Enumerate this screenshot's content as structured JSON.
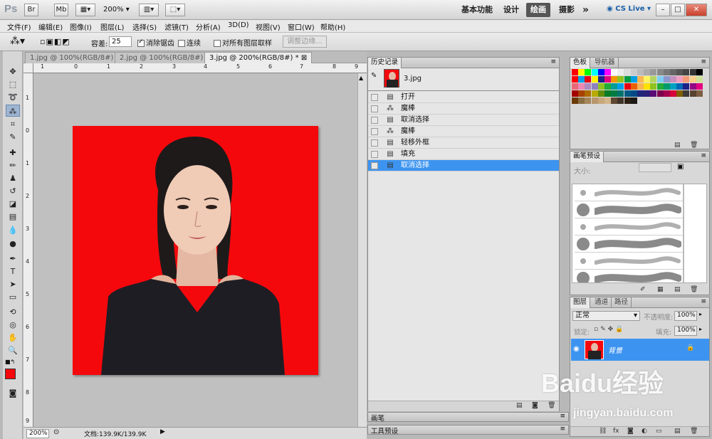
{
  "app": {
    "logo": "Ps",
    "titlebar_buttons": [
      "Br",
      "Mb"
    ],
    "zoom_display": "200%",
    "workspaces": [
      "基本功能",
      "设计",
      "绘画",
      "摄影"
    ],
    "active_workspace": "绘画",
    "more": "»",
    "cslive": "CS Live",
    "window_controls": [
      "–",
      "□",
      "✕"
    ]
  },
  "menu": [
    "文件(F)",
    "编辑(E)",
    "图像(I)",
    "图层(L)",
    "选择(S)",
    "滤镜(T)",
    "分析(A)",
    "3D(D)",
    "视图(V)",
    "窗口(W)",
    "帮助(H)"
  ],
  "options": {
    "tolerance_label": "容差:",
    "tolerance_value": "25",
    "antialias_label": "消除锯齿",
    "antialias_checked": true,
    "contiguous_label": "连续",
    "contiguous_checked": false,
    "all_layers_label": "对所有图层取样",
    "all_layers_checked": false,
    "refine_edge": "调整边缘..."
  },
  "documents": {
    "tabs": [
      "1.jpg @ 100%(RGB/8#)",
      "2.jpg @ 100%(RGB/8#)",
      "3.jpg @ 200%(RGB/8#) *"
    ],
    "active_index": 2,
    "ruler_h": [
      "1",
      "0",
      "1",
      "2",
      "3",
      "4",
      "5",
      "6",
      "7",
      "8",
      "9"
    ],
    "ruler_v": [
      "1",
      "0",
      "1",
      "2",
      "3",
      "4",
      "5",
      "6",
      "7",
      "8",
      "9"
    ],
    "zoom": "200%",
    "doc_info": "文档:139.9K/139.9K",
    "canvas_bg": "#f5080c"
  },
  "history": {
    "tabs": [
      "历史记录"
    ],
    "snapshot": "3.jpg",
    "steps": [
      "打开",
      "魔棒",
      "取消选择",
      "魔棒",
      "轻移外框",
      "填充",
      "取消选择"
    ],
    "selected_index": 6
  },
  "swatches": {
    "tabs": [
      "色板",
      "导航器"
    ]
  },
  "brushes": {
    "tab": "画笔预设",
    "size_label": "大小:"
  },
  "layers": {
    "tabs": [
      "图层",
      "通道",
      "路径"
    ],
    "blend_mode": "正常",
    "opacity_label": "不透明度:",
    "opacity_value": "100%",
    "lock_label": "锁定:",
    "fill_label": "填充:",
    "fill_value": "100%",
    "layer_name": "背景"
  },
  "bottom_panels": [
    "画笔",
    "工具预设"
  ],
  "watermark": {
    "brand": "Baidu经验",
    "url": "jingyan.baidu.com"
  },
  "colors": {
    "accent": "#3d94f0",
    "foreground": "#f5080c",
    "background": "#ffffff"
  }
}
